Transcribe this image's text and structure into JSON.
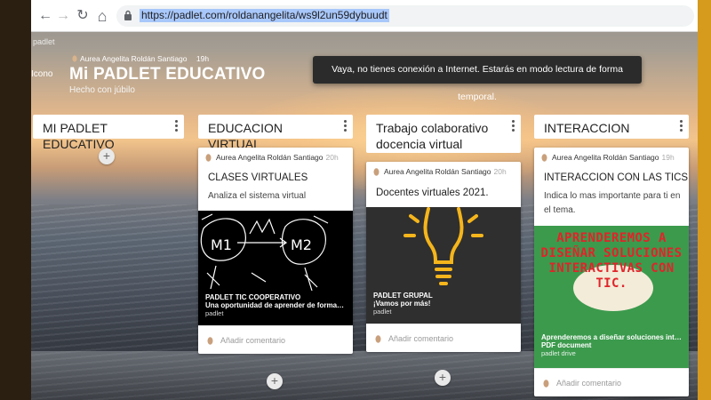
{
  "browser": {
    "url": "https://padlet.com/roldanangelita/ws9l2un59dybuudt",
    "back_icon": "←",
    "forward_icon": "→",
    "reload_icon": "↻",
    "home_icon": "⌂"
  },
  "padlet": {
    "brand": "padlet",
    "author": "Aurea Angelita Roldán Santiago",
    "time": "19h",
    "logo_alt": "Icono",
    "title": "Mi PADLET EDUCATIVO",
    "subtitle": "Hecho con júbilo"
  },
  "toast": "Vaya, no tienes conexión a Internet. Estarás en modo lectura de forma temporal.",
  "add_label": "+",
  "columns": [
    {
      "title": "MI PADLET EDUCATIVO"
    },
    {
      "title": "EDUCACION VIRTUAL"
    },
    {
      "title": "Trabajo colaborativo docencia virtual"
    },
    {
      "title": "INTERACCION"
    }
  ],
  "cards": [
    {
      "author": "Aurea Angelita Roldán Santiago",
      "time": "20h",
      "title": "CLASES VIRTUALES",
      "body": "Analiza el sistema virtual",
      "drawing_labels": [
        "M1",
        "M2"
      ],
      "caption_title": "PADLET TIC COOPERATIVO",
      "caption_sub": "Una oportunidad de aprender de forma c...",
      "caption_src": "padlet",
      "comment": "Añadir comentario"
    },
    {
      "author": "Aurea Angelita Roldán Santiago",
      "time": "20h",
      "title": "Docentes virtuales 2021.",
      "caption_title": "PADLET GRUPAL",
      "caption_sub": "¡Vamos por más!",
      "caption_src": "padlet",
      "comment": "Añadir comentario"
    },
    {
      "author": "Aurea Angelita Roldán Santiago",
      "time": "19h",
      "title": "INTERACCION CON LAS TICS",
      "body": "Indica lo mas importante para ti en el tema.",
      "poster_text": "APRENDEREMOS A DISEÑAR SOLUCIONES INTERACTIVAS CON TIC.",
      "caption_title": "Aprenderemos a diseñar soluciones inte...",
      "caption_sub": "PDF document",
      "caption_src": "padlet drive",
      "comment": "Añadir comentario"
    }
  ],
  "colors": {
    "poster_bg": "#3c9a4d",
    "poster_text": "#e0242a",
    "bulb": "#f5b51b",
    "dark_media": "#2f2f2f"
  }
}
